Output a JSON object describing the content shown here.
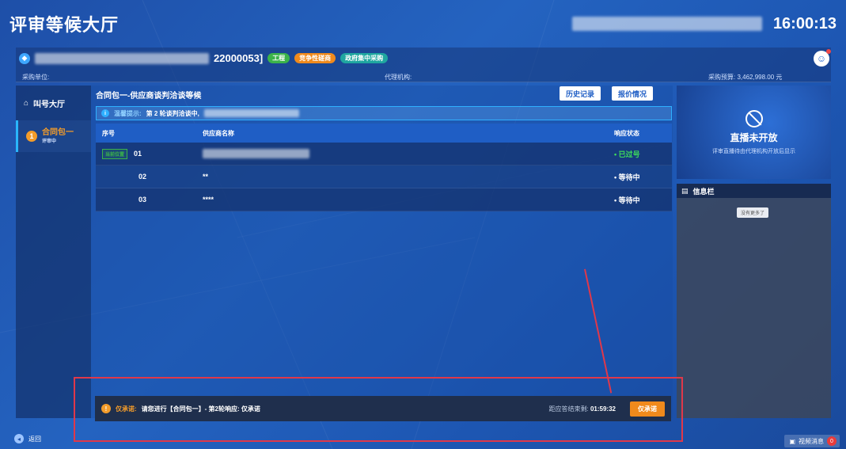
{
  "topbar": {
    "title": "评审等候大厅",
    "clock": "16:00:13"
  },
  "project": {
    "code_suffix": "22000053]",
    "tags": [
      "工程",
      "竞争性磋商",
      "政府集中采购"
    ],
    "purchaser_label": "采购单位:",
    "agency_label": "代理机构:",
    "budget_label": "采购预算:",
    "budget_value": "3,462,998.00 元"
  },
  "sidebar": {
    "hall_label": "叫号大厅",
    "package_badge": "1",
    "package_label": "合同包一",
    "package_status": "评审中"
  },
  "main": {
    "heading": "合同包一-供应商谈判洽谈等候",
    "history_btn": "历史记录",
    "quote_btn": "报价情况",
    "notice_key": "温馨提示:",
    "notice_text": "第 2 轮谈判洽谈中,",
    "table": {
      "headers": [
        "序号",
        "供应商名称",
        "响应状态"
      ],
      "rows": [
        {
          "no": "01",
          "name": "",
          "status": "• 已过号",
          "current_tag": "当前位置"
        },
        {
          "no": "02",
          "name": "**",
          "status": "• 等待中"
        },
        {
          "no": "03",
          "name": "****",
          "status": "• 等待中"
        }
      ]
    }
  },
  "right": {
    "live_title": "直播未开放",
    "live_sub": "评审直播待由代理机构开放后显示",
    "info_title": "信息栏",
    "no_more": "没有更多了"
  },
  "promise": {
    "key": "仅承诺:",
    "text": "请您进行【合同包一】- 第2轮响应: 仅承诺",
    "deadline_label": "距应答结束剩:",
    "deadline_value": "01:59:32",
    "button": "仅承诺"
  },
  "footer": {
    "back": "返回",
    "video_msg": "视频消息",
    "video_count": "0"
  }
}
